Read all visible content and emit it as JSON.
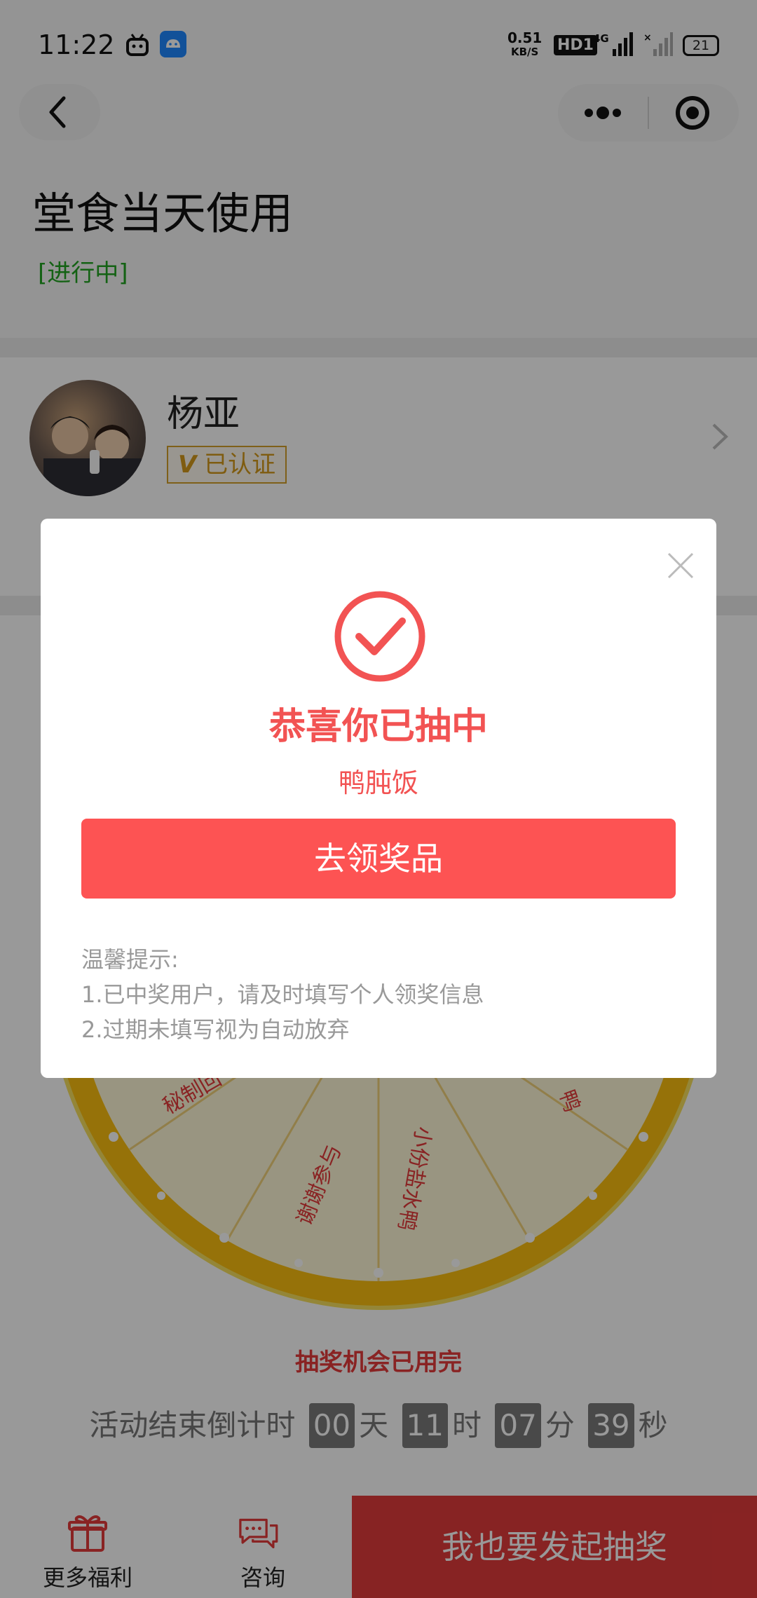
{
  "status_bar": {
    "time": "11:22",
    "net_speed_value": "0.51",
    "net_speed_unit": "KB/S",
    "hd_label": "HD1",
    "network_label": "4G",
    "battery": "21"
  },
  "header": {
    "title": "堂食当天使用",
    "status": "[进行中]"
  },
  "organizer": {
    "name": "杨亚",
    "verified_label": "已认证",
    "verified_mark": "V"
  },
  "wheel": {
    "segments": [
      "秘制回",
      "谢谢参与",
      "小份盐水鸭",
      "鸭"
    ],
    "colors": {
      "rim": "#fbbf0f",
      "rim_dark": "#d29a00",
      "face": "#fff8d8",
      "line": "#f2d27a",
      "text": "#e53b3b"
    }
  },
  "draw": {
    "chances_text": "抽奖机会已用完",
    "countdown_label": "活动结束倒计时",
    "days": "00",
    "days_unit": "天",
    "hours": "11",
    "hours_unit": "时",
    "minutes": "07",
    "minutes_unit": "分",
    "seconds": "39",
    "seconds_unit": "秒"
  },
  "bottom_bar": {
    "benefits_label": "更多福利",
    "consult_label": "咨询",
    "launch_label": "我也要发起抽奖"
  },
  "modal": {
    "title": "恭喜你已抽中",
    "prize": "鸭肫饭",
    "claim_button": "去领奖品",
    "tips_title": "温馨提示:",
    "tip1": "1.已中奖用户，请及时填写个人领奖信息",
    "tip2": "2.过期未填写视为自动放弃"
  },
  "colors": {
    "accent_red": "#fd5353",
    "status_green": "#22a322",
    "verified_gold": "#d4a02b"
  }
}
